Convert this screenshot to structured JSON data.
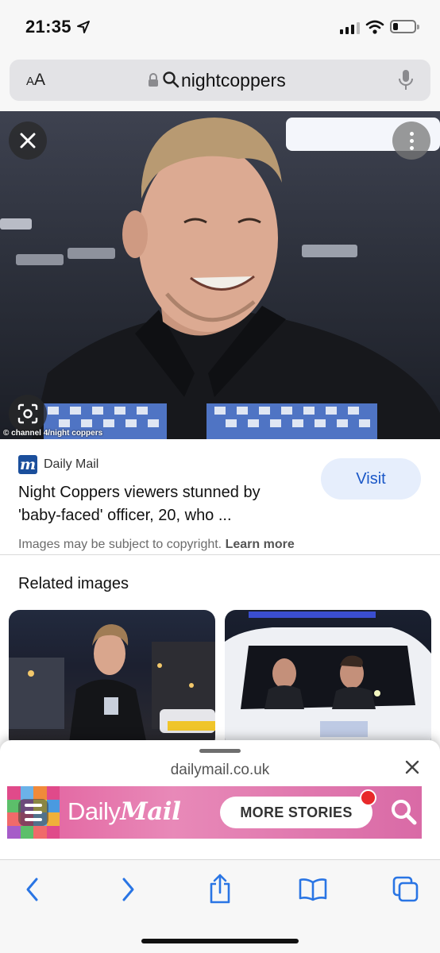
{
  "status_bar": {
    "time": "21:35",
    "location_icon": "location-arrow-icon",
    "signal_icon": "cellular-signal-icon",
    "wifi_icon": "wifi-icon",
    "battery_icon": "battery-icon",
    "battery_level": 0.25
  },
  "url_bar": {
    "text_size_label_small": "A",
    "text_size_label_large": "A",
    "query": "nightcoppers",
    "lock_icon": "lock-icon",
    "search_icon": "search-icon",
    "mic_icon": "microphone-icon"
  },
  "image_viewer": {
    "close_icon": "close-icon",
    "more_icon": "more-vertical-icon",
    "lens_icon": "lens-search-icon",
    "credit": "© channel 4/night coppers"
  },
  "result": {
    "source": "Daily Mail",
    "source_logo_letter": "m",
    "title": "Night Coppers viewers stunned by 'baby-faced' officer, 20, who ...",
    "visit_label": "Visit",
    "copyright_text": "Images may be subject to copyright.",
    "learn_more": "Learn more"
  },
  "related": {
    "heading": "Related images"
  },
  "sheet": {
    "domain": "dailymail.co.uk",
    "close_icon": "close-icon",
    "wordmark_daily": "Daily",
    "wordmark_mail": "Mail",
    "more_stories": "MORE STORIES",
    "menu_icon": "hamburger-menu-icon",
    "search_icon": "search-icon"
  },
  "toolbar": {
    "back_icon": "back-chevron-icon",
    "forward_icon": "forward-chevron-icon",
    "share_icon": "share-icon",
    "bookmarks_icon": "bookmarks-book-icon",
    "tabs_icon": "tabs-icon"
  },
  "colors": {
    "visit_text": "#1a57c7",
    "visit_bg": "#e6eefc",
    "dm_blue": "#1b4f9c",
    "dm_pink": "#e25d9c",
    "notification_red": "#e8292a"
  }
}
